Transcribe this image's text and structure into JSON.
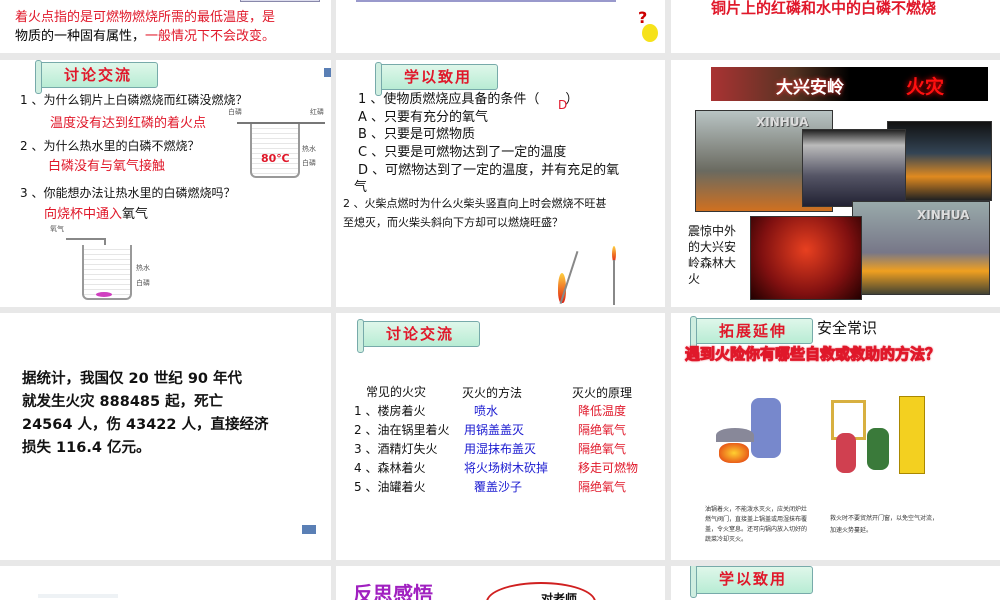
{
  "slides": {
    "s1": {
      "line1": "着火点指的是可燃物燃烧所需的最低温度，是",
      "line2a": "物质的一种固有属性，",
      "line2b": "一般情况下不会改变。"
    },
    "s3": {
      "text": "铜片上的红磷和水中的白磷不燃烧"
    },
    "s4": {
      "banner": "讨论交流",
      "q1": "1 、为什么铜片上白磷燃烧而红磷没燃烧？",
      "a1": "温度没有达到红磷的着火点",
      "q2": "2 、为什么热水里的白磷不燃烧？",
      "a2": "白磷没有与氧气接触",
      "q3": "3 、你能想办法让热水里的白磷燃烧吗？",
      "a3a": "向烧杯中通入",
      "a3b": "氧气",
      "lbl_white": "白磷",
      "lbl_red": "红磷",
      "lbl_hot": "热水",
      "lbl_white2": "白磷",
      "temp": "80℃",
      "lbl_oxygen": "氧气",
      "lbl_hot2": "热水",
      "lbl_white3": "白磷"
    },
    "s5": {
      "banner": "学以致用",
      "q1": "1 、使物质燃烧应具备的条件（　　）",
      "answer": "D",
      "optA": "A 、只要有充分的氧气",
      "optB": "B 、只要是可燃物质",
      "optC": "C 、只要是可燃物达到了一定的温度",
      "optD": "D 、可燃物达到了一定的温度，并有充足的氧",
      "optD2": "气",
      "q2a": "2 、火柴点燃时为什么火柴头竖直向上时会燃烧不旺甚",
      "q2b": "至熄灭，而火柴头斜向下方却可以燃烧旺盛？"
    },
    "s6": {
      "title_a": "大兴安岭",
      "title_b": "火灾",
      "watermark1": "XINHUA",
      "watermark2": "XINHUA",
      "caption": [
        "震惊中外",
        "的大兴安",
        "岭森林大",
        "火"
      ]
    },
    "s7": {
      "lines": [
        "据统计，我国仅 20 世纪 90 年代",
        "就发生火灾 888485 起，死亡",
        "24564 人，伤 43422 人，直接经济",
        "损失 116.4 亿元。"
      ]
    },
    "s8": {
      "banner": "讨论交流",
      "headers": [
        "常见的火灾",
        "灭火的方法",
        "灭火的原理"
      ],
      "rows": [
        [
          "1 、楼房着火",
          "喷水",
          "降低温度"
        ],
        [
          "2 、油在锅里着火",
          "用锅盖盖灭",
          "隔绝氧气"
        ],
        [
          "3 、酒精灯失火",
          "用湿抹布盖灭",
          "隔绝氧气"
        ],
        [
          "4 、森林着火",
          "将火场树木砍掉",
          "移走可燃物"
        ],
        [
          "5 、油罐着火",
          "覆盖沙子",
          "隔绝氧气"
        ]
      ]
    },
    "s9": {
      "banner": "拓展延伸",
      "title": "安全常识",
      "question": "遇到火险你有哪些自救或救助的方法？",
      "cap1": "油锅着火，不能泼水灭火，应关闭炉灶燃气阀门，直接盖上锅盖或用湿抹布覆盖，令火窒息。还可向锅内放入切好的蔬菜冷却灭火。",
      "cap2": "救火时不要贸然开门窗，以免空气对流，加速火势蔓延。"
    },
    "s11": {
      "title": "反思感悟",
      "bubble": "对老师，"
    },
    "s12": {
      "banner": "学以致用"
    }
  },
  "colors": {
    "red": "#e0182a",
    "blue": "#1a1ad0",
    "purple": "#a020c0"
  }
}
